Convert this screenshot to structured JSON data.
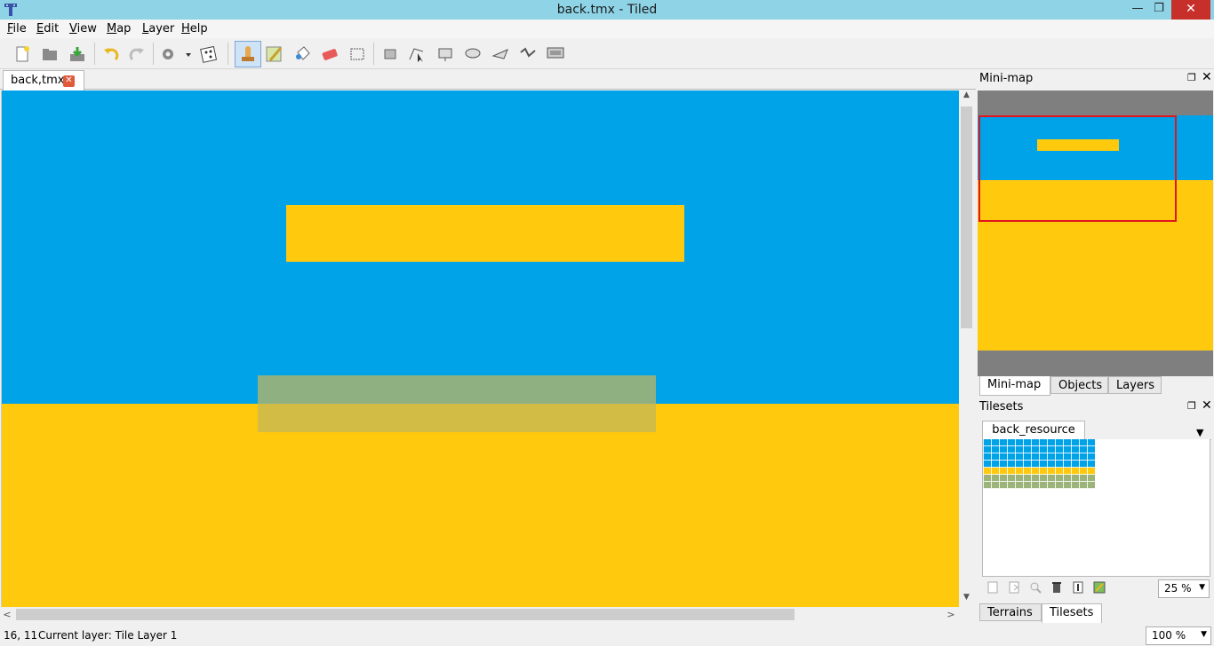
{
  "window": {
    "title": "back.tmx - Tiled",
    "minimize_glyph": "—",
    "restore_glyph": "❐",
    "close_glyph": "✕"
  },
  "menu": {
    "items": [
      {
        "label": "File"
      },
      {
        "label": "Edit"
      },
      {
        "label": "View"
      },
      {
        "label": "Map"
      },
      {
        "label": "Layer"
      },
      {
        "label": "Help"
      }
    ]
  },
  "toolbar": {
    "buttons": [
      {
        "icon": "new-file-icon"
      },
      {
        "icon": "open-folder-icon"
      },
      {
        "icon": "save-icon"
      },
      {
        "icon": "undo-icon"
      },
      {
        "icon": "redo-icon"
      },
      {
        "icon": "commands-gear-icon"
      },
      {
        "icon": "random-dice-icon"
      },
      {
        "icon": "stamp-brush-icon",
        "active": true
      },
      {
        "icon": "terrain-brush-icon"
      },
      {
        "icon": "bucket-fill-icon"
      },
      {
        "icon": "eraser-icon"
      },
      {
        "icon": "rectangle-select-icon"
      },
      {
        "icon": "select-objects-icon"
      },
      {
        "icon": "edit-polygons-icon"
      },
      {
        "icon": "insert-rectangle-icon"
      },
      {
        "icon": "insert-ellipse-icon"
      },
      {
        "icon": "insert-polygon-icon"
      },
      {
        "icon": "insert-polyline-icon"
      },
      {
        "icon": "insert-tile-icon"
      }
    ]
  },
  "document": {
    "tab_label": "back,tmx",
    "tab_close_glyph": "✕"
  },
  "map": {
    "sky_color": "#00a2e8",
    "ground_color": "#ffc90e",
    "platform_color": "#ffc90e",
    "selection_overlay_color": "#a4b47a"
  },
  "statusbar": {
    "coords": "16, 11",
    "current_layer": "Current layer: Tile Layer 1",
    "zoom": "100 %"
  },
  "minimap_panel": {
    "title": "Mini-map",
    "float_glyph": "❐",
    "close_glyph": "✕",
    "viewport_color": "#e0151d"
  },
  "upper_dock_tabs": [
    {
      "label": "Mini-map",
      "selected": true
    },
    {
      "label": "Objects",
      "selected": false
    },
    {
      "label": "Layers",
      "selected": false
    }
  ],
  "tilesets_panel": {
    "title": "Tilesets",
    "float_glyph": "❐",
    "close_glyph": "✕",
    "tileset_tab": "back_resource",
    "dropdown_glyph": "▼",
    "zoom": "25 %",
    "tool_icons": [
      "new-tileset-icon",
      "import-tileset-icon",
      "export-tileset-icon",
      "delete-tileset-icon",
      "edit-terrain-icon",
      "tileset-properties-icon"
    ]
  },
  "lower_dock_tabs": [
    {
      "label": "Terrains",
      "selected": false
    },
    {
      "label": "Tilesets",
      "selected": true
    }
  ],
  "scroll": {
    "up_glyph": "▲",
    "down_glyph": "▼",
    "left_glyph": "<",
    "right_glyph": ">"
  }
}
